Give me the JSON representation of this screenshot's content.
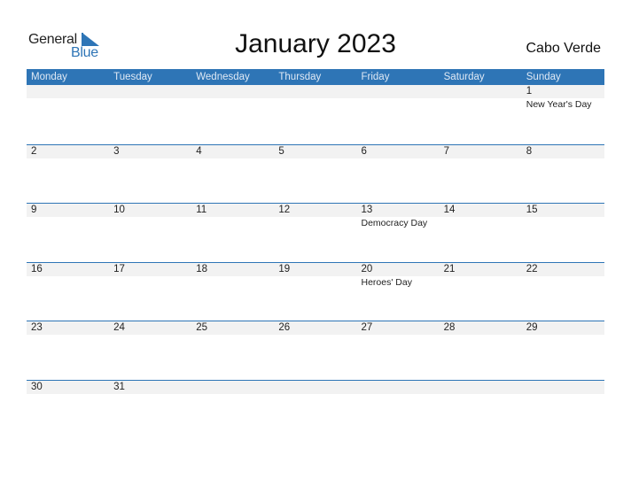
{
  "logo": {
    "line1": "General",
    "line2": "Blue"
  },
  "title": "January 2023",
  "country": "Cabo Verde",
  "colors": {
    "accent": "#2e75b6",
    "band": "#f2f2f2"
  },
  "weekdays": [
    "Monday",
    "Tuesday",
    "Wednesday",
    "Thursday",
    "Friday",
    "Saturday",
    "Sunday"
  ],
  "weeks": [
    [
      {
        "day": "",
        "holiday": ""
      },
      {
        "day": "",
        "holiday": ""
      },
      {
        "day": "",
        "holiday": ""
      },
      {
        "day": "",
        "holiday": ""
      },
      {
        "day": "",
        "holiday": ""
      },
      {
        "day": "",
        "holiday": ""
      },
      {
        "day": "1",
        "holiday": "New Year's Day"
      }
    ],
    [
      {
        "day": "2",
        "holiday": ""
      },
      {
        "day": "3",
        "holiday": ""
      },
      {
        "day": "4",
        "holiday": ""
      },
      {
        "day": "5",
        "holiday": ""
      },
      {
        "day": "6",
        "holiday": ""
      },
      {
        "day": "7",
        "holiday": ""
      },
      {
        "day": "8",
        "holiday": ""
      }
    ],
    [
      {
        "day": "9",
        "holiday": ""
      },
      {
        "day": "10",
        "holiday": ""
      },
      {
        "day": "11",
        "holiday": ""
      },
      {
        "day": "12",
        "holiday": ""
      },
      {
        "day": "13",
        "holiday": "Democracy Day"
      },
      {
        "day": "14",
        "holiday": ""
      },
      {
        "day": "15",
        "holiday": ""
      }
    ],
    [
      {
        "day": "16",
        "holiday": ""
      },
      {
        "day": "17",
        "holiday": ""
      },
      {
        "day": "18",
        "holiday": ""
      },
      {
        "day": "19",
        "holiday": ""
      },
      {
        "day": "20",
        "holiday": "Heroes' Day"
      },
      {
        "day": "21",
        "holiday": ""
      },
      {
        "day": "22",
        "holiday": ""
      }
    ],
    [
      {
        "day": "23",
        "holiday": ""
      },
      {
        "day": "24",
        "holiday": ""
      },
      {
        "day": "25",
        "holiday": ""
      },
      {
        "day": "26",
        "holiday": ""
      },
      {
        "day": "27",
        "holiday": ""
      },
      {
        "day": "28",
        "holiday": ""
      },
      {
        "day": "29",
        "holiday": ""
      }
    ],
    [
      {
        "day": "30",
        "holiday": ""
      },
      {
        "day": "31",
        "holiday": ""
      },
      {
        "day": "",
        "holiday": ""
      },
      {
        "day": "",
        "holiday": ""
      },
      {
        "day": "",
        "holiday": ""
      },
      {
        "day": "",
        "holiday": ""
      },
      {
        "day": "",
        "holiday": ""
      }
    ]
  ]
}
